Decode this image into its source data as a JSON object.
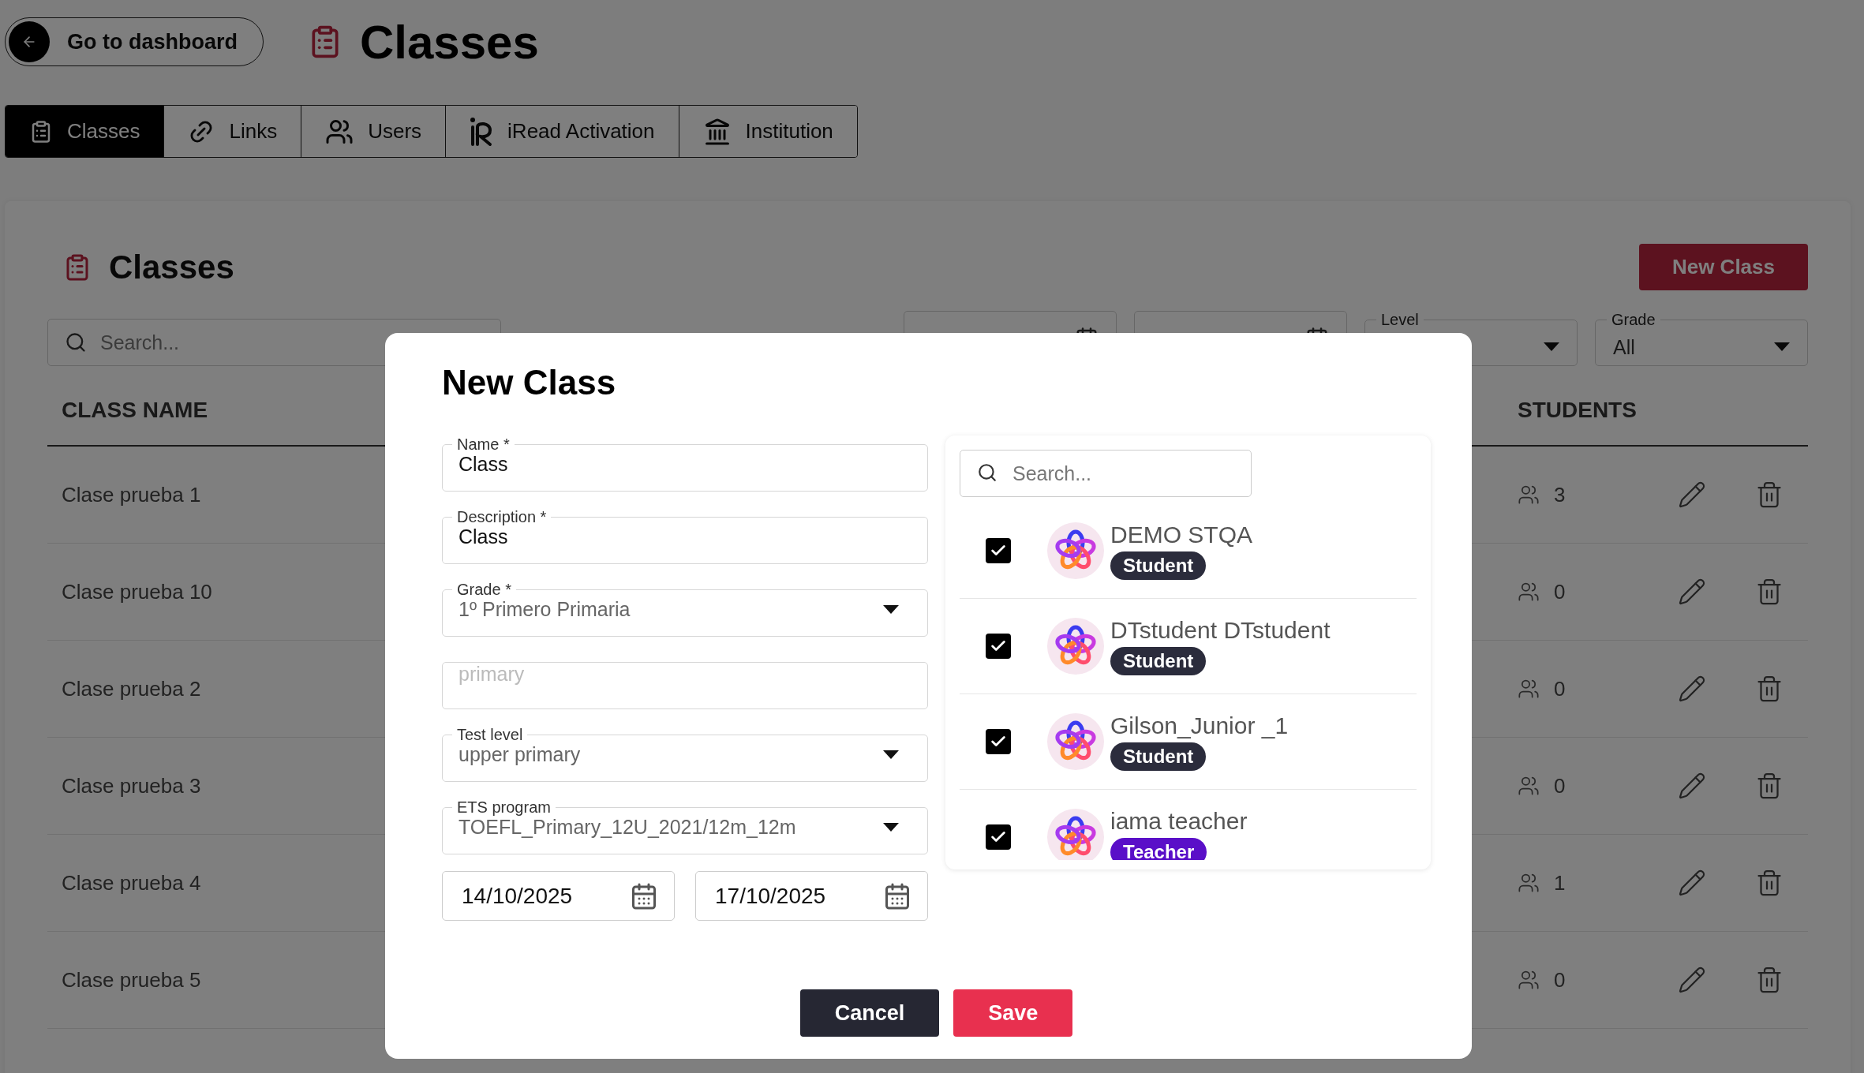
{
  "header": {
    "back_button": "Go to dashboard",
    "title": "Classes"
  },
  "tabs": [
    {
      "label": "Classes",
      "selected": true
    },
    {
      "label": "Links",
      "selected": false
    },
    {
      "label": "Users",
      "selected": false
    },
    {
      "label": "iRead Activation",
      "selected": false
    },
    {
      "label": "Institution",
      "selected": false
    }
  ],
  "panel": {
    "title": "Classes",
    "new_button": "New Class",
    "search": {
      "placeholder": "Search..."
    },
    "filters": [
      {
        "kind": "date"
      },
      {
        "kind": "date"
      },
      {
        "kind": "select",
        "label": "Level"
      },
      {
        "kind": "select",
        "label": "Grade",
        "value": "All"
      }
    ],
    "columns": [
      "CLASS NAME",
      "STUDENTS"
    ],
    "rows": [
      {
        "name": "Clase prueba 1",
        "students": "3"
      },
      {
        "name": "Clase prueba 10",
        "students": "0"
      },
      {
        "name": "Clase prueba 2",
        "students": "0"
      },
      {
        "name": "Clase prueba 3",
        "students": "0"
      },
      {
        "name": "Clase prueba 4",
        "students": "1"
      },
      {
        "name": "Clase prueba 5",
        "students": "0"
      }
    ]
  },
  "dialog": {
    "title": "New Class",
    "fields": [
      {
        "kind": "text",
        "label": "Name *",
        "value": "Class"
      },
      {
        "kind": "text",
        "label": "Description *",
        "value": "Class"
      },
      {
        "kind": "select",
        "label": "Grade *",
        "value": "1º Primero Primaria"
      },
      {
        "kind": "text",
        "placeholder": "primary"
      },
      {
        "kind": "select",
        "label": "Test level",
        "value": "upper primary"
      },
      {
        "kind": "select",
        "label": "ETS program",
        "value": "TOEFL_Primary_12U_2021/12m_12m"
      }
    ],
    "dates": [
      "14/10/2025",
      "17/10/2025"
    ],
    "member_search": {
      "placeholder": "Search..."
    },
    "members": [
      {
        "name": "DEMO STQA",
        "role": "Student",
        "color": "#2b2c3c",
        "checked": true
      },
      {
        "name": "DTstudent DTstudent",
        "role": "Student",
        "color": "#2b2c3c",
        "checked": true
      },
      {
        "name": "Gilson_Junior _1",
        "role": "Student",
        "color": "#2b2c3c",
        "checked": true
      },
      {
        "name": "iama teacher",
        "role": "Teacher",
        "color": "#5a0fc8",
        "checked": true
      }
    ],
    "buttons": [
      {
        "kind": "cancel",
        "label": "Cancel"
      },
      {
        "kind": "save",
        "label": "Save"
      }
    ]
  }
}
